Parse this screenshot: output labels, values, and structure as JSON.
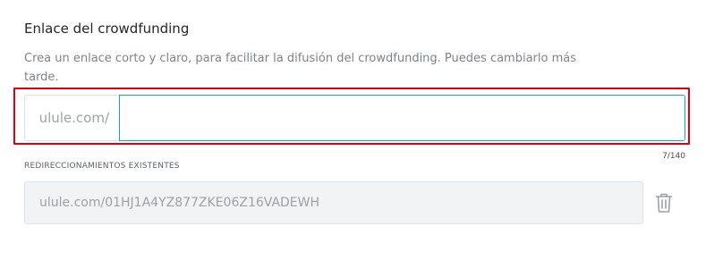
{
  "section": {
    "title": "Enlace del crowdfunding",
    "description": "Crea un enlace corto y claro, para facilitar la difusión del crowdfunding. Puedes cambiarlo más tarde."
  },
  "url_field": {
    "prefix": "ulule.com/",
    "value": "",
    "placeholder": "",
    "char_count": "7/140"
  },
  "redirects": {
    "label": "REDIRECCIONAMIENTOS EXISTENTES",
    "items": [
      {
        "url": "ulule.com/01HJ1A4YZ877ZKE06Z16VADEWH",
        "delete_icon": "trash-icon"
      }
    ]
  },
  "colors": {
    "annotation": "#e0000b",
    "focus_border": "#18a6bf"
  }
}
